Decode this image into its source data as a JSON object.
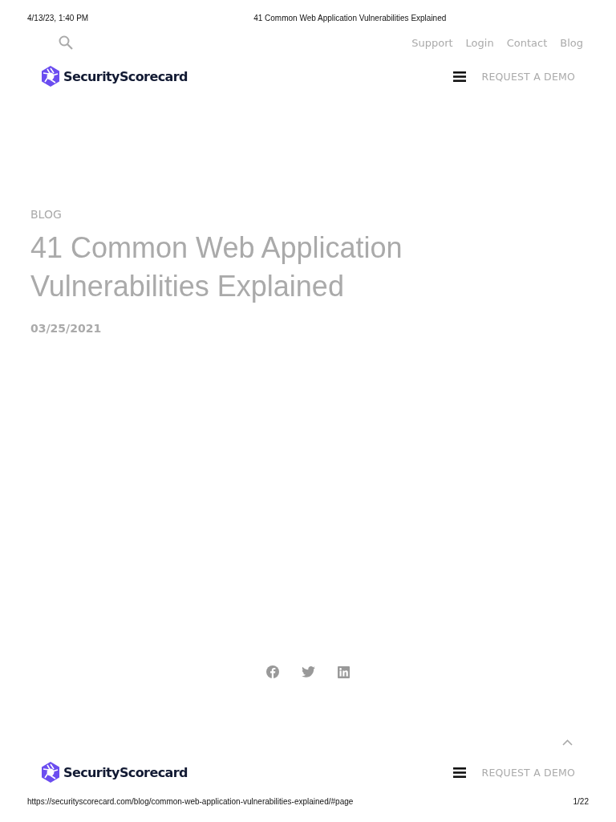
{
  "print_header": {
    "date": "4/13/23, 1:40 PM",
    "title": "41 Common Web Application Vulnerabilities Explained"
  },
  "top_nav": {
    "links": [
      "Support",
      "Login",
      "Contact",
      "Blog"
    ]
  },
  "header": {
    "logo": "SecurityScorecard",
    "cta": "REQUEST A DEMO"
  },
  "article": {
    "category": "BLOG",
    "title": "41 Common Web Application Vulnerabilities Explained",
    "date": "03/25/2021"
  },
  "share": [
    {
      "kind": "facebook"
    },
    {
      "kind": "twitter"
    },
    {
      "kind": "linkedin"
    }
  ],
  "footer_header": {
    "logo": "SecurityScorecard",
    "cta": "REQUEST A DEMO"
  },
  "print_footer": {
    "url": "https://securityscorecard.com/blog/common-web-application-vulnerabilities-explained/#page",
    "page": "1/22"
  }
}
